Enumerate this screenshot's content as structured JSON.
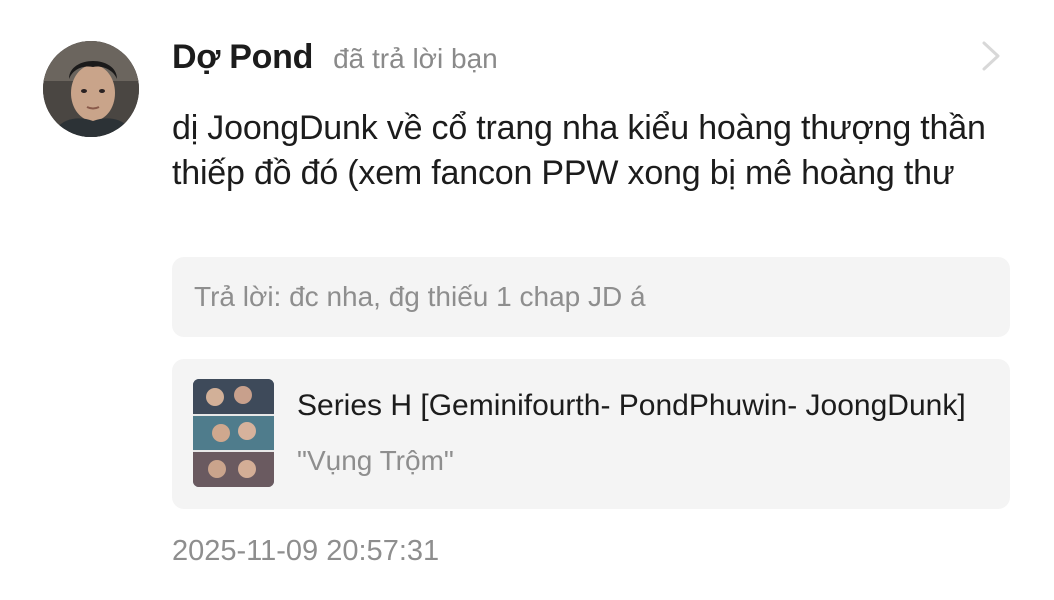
{
  "notification": {
    "username": "Dợ Pond",
    "action": "đã trả lời bạn",
    "message": "dị JoongDunk về cổ trang nha kiểu hoàng thượng thần thiếp đồ đó (xem fancon PPW xong bị mê hoàng thư",
    "reply_quote": "Trả lời: đc nha, đg thiếu 1 chap JD á",
    "story": {
      "title": "Series H [Geminifourth- PondPhuwin- JoongDunk]",
      "chapter": "\"Vụng Trộm\""
    },
    "timestamp": "2025-11-09 20:57:31"
  },
  "icons": {
    "avatar": "user-avatar-photo",
    "chevron": "chevron-right-icon",
    "cover": "story-cover-thumbnail"
  },
  "colors": {
    "background": "#ffffff",
    "primary_text": "#1c1c1c",
    "secondary_text": "#8e8e8e",
    "panel": "#f4f4f4",
    "chevron": "#d8d8d8"
  }
}
